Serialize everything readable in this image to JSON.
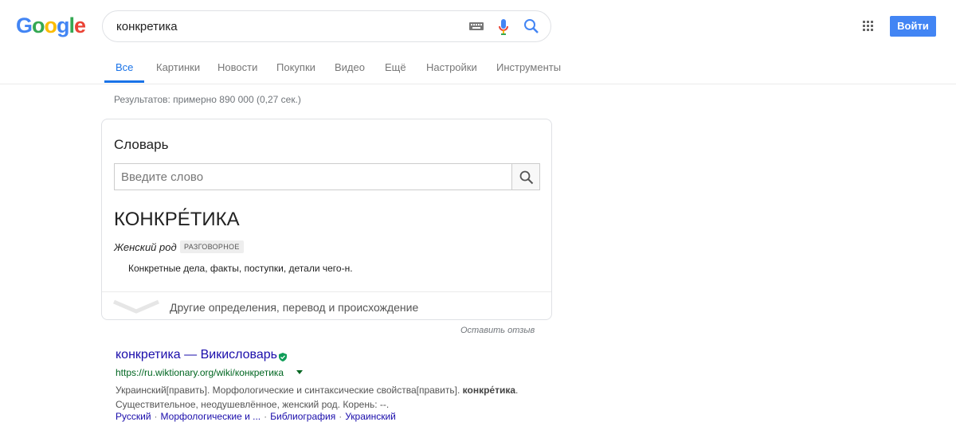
{
  "logo": {
    "letters": [
      "G",
      "o",
      "o",
      "g",
      "l",
      "e"
    ],
    "colors": [
      "#4285f4",
      "#ea4335",
      "#fbbc05",
      "#4285f4",
      "#34a853",
      "#ea4335"
    ]
  },
  "search": {
    "query": "конкретика"
  },
  "header": {
    "signin_label": "Войти"
  },
  "tabs": [
    {
      "label": "Все",
      "active": true
    },
    {
      "label": "Картинки"
    },
    {
      "label": "Новости"
    },
    {
      "label": "Покупки"
    },
    {
      "label": "Видео"
    },
    {
      "label": "Ещё"
    },
    {
      "label": "Настройки"
    },
    {
      "label": "Инструменты"
    }
  ],
  "stats": "Результатов: примерно 890 000 (0,27 сек.)",
  "dictionary": {
    "title": "Словарь",
    "input_placeholder": "Введите слово",
    "headword": "КОНКРЕ́ТИКА",
    "part_of_speech": "Женский род",
    "badge": "РАЗГОВОРНОЕ",
    "definition": "Конкретные дела, факты, поступки, детали чего-н.",
    "more_label": "Другие определения, перевод и происхождение",
    "feedback": "Оставить отзыв"
  },
  "result": {
    "title": "конкретика — Викисловарь",
    "url": "https://ru.wiktionary.org/wiki/конкретика",
    "snippet_part1": "Украинский[править]. Морфологические и синтаксические свойства[править]. ",
    "snippet_bold": "конкре́тика",
    "snippet_part2": ". Существительное, неодушевлённое, женский род. Корень: --.",
    "sublinks": [
      "Русский",
      "Морфологические и ...",
      "Библиография",
      "Украинский"
    ]
  },
  "colors": {
    "accent": "#1a73e8",
    "link": "#1a0dab",
    "url": "#006621",
    "signin_bg": "#4285f4"
  }
}
